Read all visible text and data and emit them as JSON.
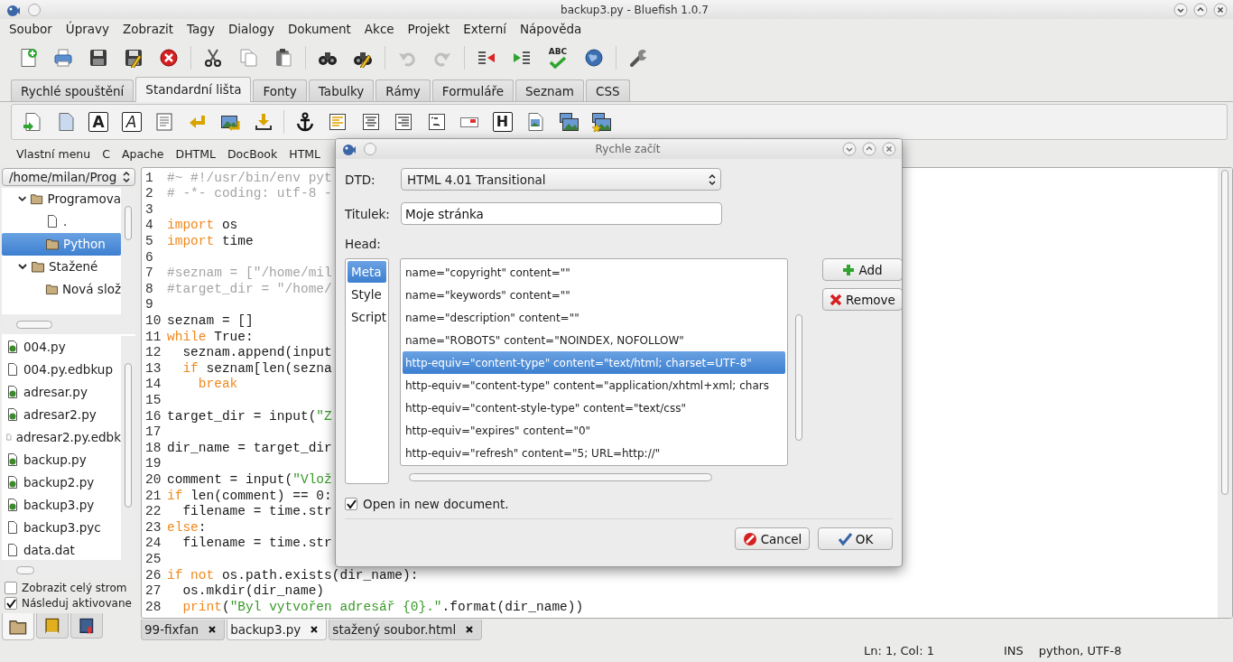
{
  "window": {
    "title": "backup3.py - Bluefish 1.0.7"
  },
  "menu": [
    "Soubor",
    "Úpravy",
    "Zobrazit",
    "Tagy",
    "Dialogy",
    "Dokument",
    "Akce",
    "Projekt",
    "Externí",
    "Nápověda"
  ],
  "toolbar": [
    {
      "disabled": false
    },
    {
      "disabled": false
    },
    {
      "disabled": false
    },
    {
      "disabled": false
    },
    {
      "disabled": false
    },
    {
      "disabled": false
    },
    {
      "disabled": false
    },
    {
      "disabled": false
    },
    {
      "disabled": false
    },
    {
      "disabled": false
    },
    {
      "disabled": true
    },
    {
      "disabled": true
    },
    {
      "disabled": false
    },
    {
      "disabled": false
    },
    {
      "disabled": false,
      "glyph": "ABC"
    },
    {
      "disabled": false
    },
    {
      "disabled": false
    }
  ],
  "tabs": [
    {
      "label": "Rychlé spouštění",
      "selected": false
    },
    {
      "label": "Standardní lišta",
      "selected": true
    },
    {
      "label": "Fonty",
      "selected": false
    },
    {
      "label": "Tabulky",
      "selected": false
    },
    {
      "label": "Rámy",
      "selected": false
    },
    {
      "label": "Formuláře",
      "selected": false
    },
    {
      "label": "Seznam",
      "selected": false
    },
    {
      "label": "CSS",
      "selected": false
    }
  ],
  "tag_toolbar": {
    "bold": "A",
    "italic": "A",
    "heading": "H"
  },
  "custom_menu": [
    "Vlastní menu",
    "C",
    "Apache",
    "DHTML",
    "DocBook",
    "HTML"
  ],
  "sidebar": {
    "path": "/home/milan/Prog",
    "tree": [
      {
        "label": "Programova",
        "kind": "folder",
        "expanded": true,
        "selected": false,
        "children": [
          {
            "label": ".",
            "kind": "file",
            "selected": false
          },
          {
            "label": "Python",
            "kind": "folder",
            "selected": true
          }
        ]
      },
      {
        "label": "Stažené",
        "kind": "folder",
        "expanded": true,
        "selected": false,
        "children": [
          {
            "label": "Nová slož",
            "kind": "folder",
            "selected": false
          }
        ]
      }
    ],
    "files": [
      {
        "name": "004.py",
        "kind": "python"
      },
      {
        "name": "004.py.edbkup",
        "kind": "file"
      },
      {
        "name": "adresar.py",
        "kind": "python"
      },
      {
        "name": "adresar2.py",
        "kind": "python"
      },
      {
        "name": "adresar2.py.edbk",
        "kind": "file"
      },
      {
        "name": "backup.py",
        "kind": "python"
      },
      {
        "name": "backup2.py",
        "kind": "python"
      },
      {
        "name": "backup3.py",
        "kind": "python"
      },
      {
        "name": "backup3.pyc",
        "kind": "file"
      },
      {
        "name": "data.dat",
        "kind": "file"
      }
    ],
    "options": [
      {
        "label": "Zobrazit celý strom",
        "checked": false
      },
      {
        "label": "Následuj aktivovane",
        "checked": true
      }
    ],
    "panels": [
      {
        "selected": true
      },
      {
        "selected": false
      },
      {
        "selected": false
      }
    ]
  },
  "editor": {
    "lines": [
      {
        "number": "1",
        "segments": [
          {
            "kind": "comment",
            "text": "#~ #!/usr/bin/env pyt"
          }
        ]
      },
      {
        "number": "2",
        "segments": [
          {
            "kind": "comment",
            "text": "# -*- coding: utf-8 -"
          }
        ]
      },
      {
        "number": "3"
      },
      {
        "number": "4",
        "segments": [
          {
            "kind": "keyword",
            "text": "import"
          },
          {
            "kind": "plain",
            "text": " os"
          }
        ]
      },
      {
        "number": "5",
        "segments": [
          {
            "kind": "keyword",
            "text": "import"
          },
          {
            "kind": "plain",
            "text": " time"
          }
        ]
      },
      {
        "number": "6"
      },
      {
        "number": "7",
        "segments": [
          {
            "kind": "comment",
            "text": "#seznam = [\"/home/mil"
          }
        ]
      },
      {
        "number": "8",
        "segments": [
          {
            "kind": "comment",
            "text": "#target_dir = \"/home/"
          }
        ]
      },
      {
        "number": "9"
      },
      {
        "number": "10",
        "segments": [
          {
            "kind": "plain",
            "text": "seznam = []"
          }
        ]
      },
      {
        "number": "11",
        "segments": [
          {
            "kind": "keyword",
            "text": "while"
          },
          {
            "kind": "plain",
            "text": " True:"
          }
        ]
      },
      {
        "number": "12",
        "segments": [
          {
            "kind": "plain",
            "text": "  seznam.append(input"
          }
        ]
      },
      {
        "number": "13",
        "segments": [
          {
            "kind": "keyword",
            "text": "  if"
          },
          {
            "kind": "plain",
            "text": " seznam[len(sezna"
          }
        ]
      },
      {
        "number": "14",
        "segments": [
          {
            "kind": "keyword",
            "text": "    break"
          }
        ]
      },
      {
        "number": "15"
      },
      {
        "number": "16",
        "segments": [
          {
            "kind": "plain",
            "text": "target_dir = input("
          },
          {
            "kind": "string",
            "text": "\"Z"
          }
        ]
      },
      {
        "number": "17"
      },
      {
        "number": "18",
        "segments": [
          {
            "kind": "plain",
            "text": "dir_name = target_dir"
          }
        ]
      },
      {
        "number": "19"
      },
      {
        "number": "20",
        "segments": [
          {
            "kind": "plain",
            "text": "comment = input("
          },
          {
            "kind": "string",
            "text": "\"Vlož"
          }
        ]
      },
      {
        "number": "21",
        "segments": [
          {
            "kind": "keyword",
            "text": "if"
          },
          {
            "kind": "plain",
            "text": " len(comment) == 0:"
          }
        ]
      },
      {
        "number": "22",
        "segments": [
          {
            "kind": "plain",
            "text": "  filename = time.str"
          }
        ]
      },
      {
        "number": "23",
        "segments": [
          {
            "kind": "keyword",
            "text": "else"
          },
          {
            "kind": "plain",
            "text": ":"
          }
        ]
      },
      {
        "number": "24",
        "segments": [
          {
            "kind": "plain",
            "text": "  filename = time.str"
          }
        ]
      },
      {
        "number": "25"
      },
      {
        "number": "26",
        "segments": [
          {
            "kind": "keyword",
            "text": "if not"
          },
          {
            "kind": "plain",
            "text": " os.path.exists(dir_name):"
          }
        ]
      },
      {
        "number": "27",
        "segments": [
          {
            "kind": "plain",
            "text": "  os.mkdir(dir_name)"
          }
        ]
      },
      {
        "number": "28",
        "segments": [
          {
            "kind": "keyword",
            "text": "  print"
          },
          {
            "kind": "plain",
            "text": "("
          },
          {
            "kind": "string",
            "text": "\"Byl vytvořen adresář {0}.\""
          },
          {
            "kind": "plain",
            "text": ".format(dir_name))"
          }
        ]
      }
    ]
  },
  "documents": [
    {
      "label": "99-fixfan",
      "selected": false
    },
    {
      "label": "backup3.py",
      "selected": true
    },
    {
      "label": "stažený soubor.html",
      "selected": false
    }
  ],
  "status_bar": {
    "position": "Ln: 1, Col: 1",
    "mode": "INS",
    "language": "python, UTF-8"
  },
  "dialog": {
    "title": "Rychle začít",
    "dtd": {
      "label": "DTD:",
      "value": "HTML 4.01 Transitional"
    },
    "title_field": {
      "label": "Titulek:",
      "value": "Moje stránka"
    },
    "head_label": "Head:",
    "categories": [
      {
        "label": "Meta",
        "selected": true
      },
      {
        "label": "Style",
        "selected": false
      },
      {
        "label": "Script",
        "selected": false
      }
    ],
    "entries": [
      {
        "text": "name=\"copyright\" content=\"\"",
        "selected": false
      },
      {
        "text": "name=\"keywords\" content=\"\"",
        "selected": false
      },
      {
        "text": "name=\"description\" content=\"\"",
        "selected": false
      },
      {
        "text": "name=\"ROBOTS\" content=\"NOINDEX, NOFOLLOW\"",
        "selected": false
      },
      {
        "text": "http-equiv=\"content-type\" content=\"text/html; charset=UTF-8\"",
        "selected": true
      },
      {
        "text": "http-equiv=\"content-type\" content=\"application/xhtml+xml; chars",
        "selected": false
      },
      {
        "text": "http-equiv=\"content-style-type\" content=\"text/css\"",
        "selected": false
      },
      {
        "text": "http-equiv=\"expires\" content=\"0\"",
        "selected": false
      },
      {
        "text": "http-equiv=\"refresh\" content=\"5; URL=http://\"",
        "selected": false
      }
    ],
    "add": "Add",
    "remove": "Remove",
    "open_new": {
      "label": "Open in new document.",
      "checked": true
    },
    "cancel": "Cancel",
    "ok": "OK"
  }
}
